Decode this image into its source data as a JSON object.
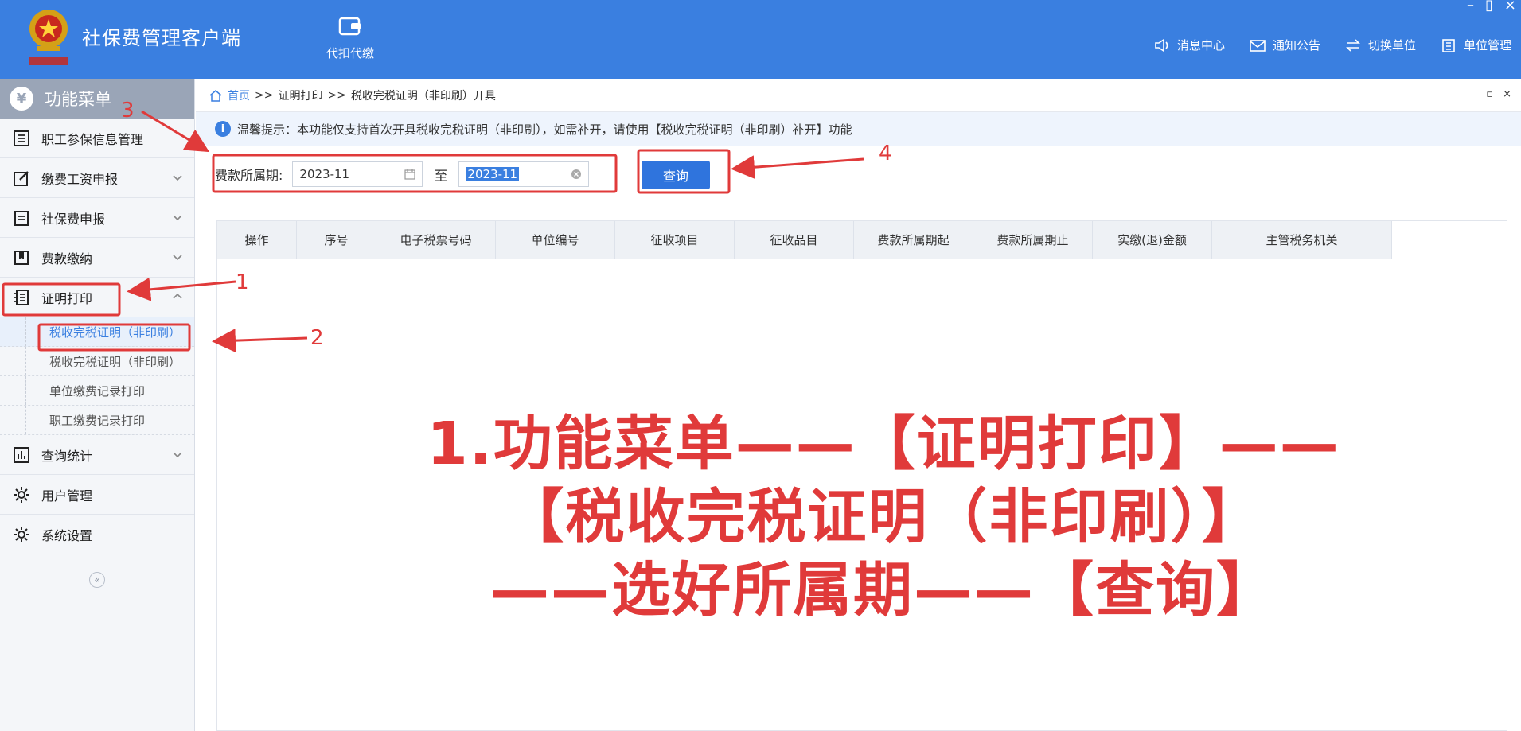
{
  "header": {
    "app_title": "社保费管理客户端",
    "module_label": "代扣代缴",
    "actions": [
      {
        "label": "消息中心",
        "icon": "speaker-icon"
      },
      {
        "label": "通知公告",
        "icon": "mail-icon"
      },
      {
        "label": "切换单位",
        "icon": "switch-icon"
      },
      {
        "label": "单位管理",
        "icon": "building-icon"
      }
    ]
  },
  "sidebar": {
    "title": "功能菜单",
    "items": [
      {
        "label": "职工参保信息管理"
      },
      {
        "label": "缴费工资申报"
      },
      {
        "label": "社保费申报"
      },
      {
        "label": "费款缴纳"
      },
      {
        "label": "证明打印"
      },
      {
        "label": "查询统计"
      },
      {
        "label": "用户管理"
      },
      {
        "label": "系统设置"
      }
    ],
    "sub_items": [
      {
        "label": "税收完税证明（非印刷）"
      },
      {
        "label": "税收完税证明（非印刷）"
      },
      {
        "label": "单位缴费记录打印"
      },
      {
        "label": "职工缴费记录打印"
      }
    ],
    "collapse_glyph": "«"
  },
  "breadcrumb": {
    "home": "首页",
    "sep": ">>",
    "level1": "证明打印",
    "level2": "税收完税证明（非印刷）开具"
  },
  "tip": {
    "text": "温馨提示：本功能仅支持首次开具税收完税证明（非印刷），如需补开，请使用【税收完税证明（非印刷）补开】功能"
  },
  "query": {
    "label": "费款所属期:",
    "from": "2023-11",
    "to_label": "至",
    "to": "2023-11",
    "button": "查询"
  },
  "table": {
    "columns": [
      "操作",
      "序号",
      "电子税票号码",
      "单位编号",
      "征收项目",
      "征收品目",
      "费款所属期起",
      "费款所属期止",
      "实缴(退)金额",
      "主管税务机关"
    ]
  },
  "annotation": {
    "line1": "1.功能菜单——【证明打印】——",
    "line2": "【税收完税证明（非印刷）】",
    "line3": "——选好所属期——【查询】",
    "markers": [
      "1",
      "2",
      "3",
      "4"
    ],
    "color": "#e03a3a"
  },
  "colors": {
    "header_bg": "#3a7fe0",
    "accent": "#2f74dd",
    "annotation": "#e03a3a"
  }
}
